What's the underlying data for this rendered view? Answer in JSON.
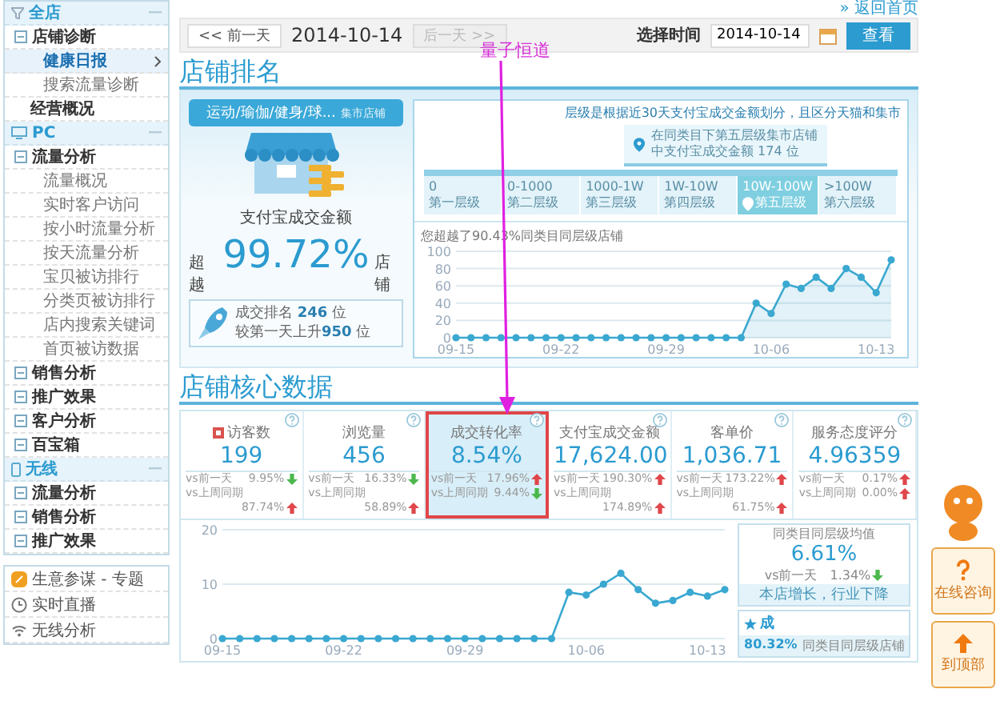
{
  "sidebar": {
    "sections": [
      {
        "title": "全店",
        "kind": "store",
        "items": [
          {
            "label": "店铺诊断",
            "kind": "group",
            "selected": false,
            "children": [
              {
                "label": "健康日报",
                "kind": "link",
                "selected": true
              },
              {
                "label": "搜索流量诊断",
                "kind": "link",
                "selected": false
              }
            ]
          },
          {
            "label": "经营概况",
            "kind": "link",
            "selected": false
          }
        ]
      },
      {
        "title": "PC",
        "kind": "pc",
        "items": [
          {
            "label": "流量分析",
            "kind": "group",
            "selected": false,
            "children": [
              {
                "label": "流量概况",
                "kind": "link",
                "selected": false
              },
              {
                "label": "实时客户访问",
                "kind": "link",
                "selected": false
              },
              {
                "label": "按小时流量分析",
                "kind": "link",
                "selected": false
              },
              {
                "label": "按天流量分析",
                "kind": "link",
                "selected": false
              },
              {
                "label": "宝贝被访排行",
                "kind": "link",
                "selected": false
              },
              {
                "label": "分类页被访排行",
                "kind": "link",
                "selected": false
              },
              {
                "label": "店内搜索关键词",
                "kind": "link",
                "selected": false
              },
              {
                "label": "首页被访数据",
                "kind": "link",
                "selected": false
              }
            ]
          },
          {
            "label": "销售分析",
            "kind": "group",
            "selected": false
          },
          {
            "label": "推广效果",
            "kind": "group",
            "selected": false
          },
          {
            "label": "客户分析",
            "kind": "group",
            "selected": false
          },
          {
            "label": "百宝箱",
            "kind": "group",
            "selected": false
          }
        ]
      },
      {
        "title": "无线",
        "kind": "mobile",
        "items": [
          {
            "label": "流量分析",
            "kind": "group",
            "selected": false
          },
          {
            "label": "销售分析",
            "kind": "group",
            "selected": false
          },
          {
            "label": "推广效果",
            "kind": "group",
            "selected": false
          }
        ]
      }
    ],
    "tools": [
      {
        "kind": "topic",
        "label": "生意参谋 - 专题"
      },
      {
        "kind": "live",
        "label": "实时直播"
      },
      {
        "kind": "wireless",
        "label": "无线分析"
      }
    ]
  },
  "top_link": "» 返回首页",
  "toolbar": {
    "prev_button": "<< 前一天",
    "date": "2014-10-14",
    "next_button": {
      "label": "后一天 >>",
      "disabled": true
    },
    "time_label": "选择时间",
    "time_input": "2014-10-14",
    "view_button": "查看"
  },
  "annotation": "量子恒道",
  "ranking": {
    "title": "店铺排名",
    "category": "运动/瑜伽/健身/球...",
    "shop_type": "集市店铺",
    "metric": "支付宝成交金额",
    "beat_prefix": "超越",
    "beat_value": "99.72%",
    "beat_suffix": "店铺",
    "rank_line": "成交排名 **246** 位",
    "rise_line": "较第一天上升**950** 位",
    "note": "层级是根据近30天支付宝成交金额划分，且区分天猫和集市",
    "tooltip": [
      "在同类目下第五层级集市店铺",
      "中支付宝成交金额 174 位"
    ],
    "tiers": [
      {
        "range": "0",
        "name": "第一层级",
        "selected": false
      },
      {
        "range": "0-1000",
        "name": "第二层级",
        "selected": false
      },
      {
        "range": "1000-1W",
        "name": "第三层级",
        "selected": false
      },
      {
        "range": "1W-10W",
        "name": "第四层级",
        "selected": false
      },
      {
        "range": "10W-100W",
        "name": "第五层级",
        "selected": true
      },
      {
        "range": ">100W",
        "name": "第六层级",
        "selected": false
      }
    ],
    "chart_data": {
      "type": "area",
      "title": "您超越了90.43%同类目同层级店铺",
      "categories": [
        "09-15",
        null,
        null,
        null,
        null,
        null,
        null,
        "09-22",
        null,
        null,
        null,
        null,
        null,
        null,
        "09-29",
        null,
        null,
        null,
        null,
        null,
        null,
        "10-06",
        null,
        null,
        null,
        null,
        null,
        null,
        "10-13",
        null
      ],
      "ylim": [
        0,
        100
      ],
      "yticks": [
        0,
        20,
        40,
        60,
        80,
        100
      ],
      "grid": true,
      "series": [
        {
          "color": "#3aa8d0",
          "marker": true,
          "values": [
            0,
            0,
            0,
            0,
            0,
            0,
            0,
            0,
            0,
            0,
            0,
            0,
            0,
            0,
            0,
            0,
            0,
            0,
            0,
            0,
            40,
            28,
            62,
            57,
            70,
            57,
            80,
            70,
            52,
            90
          ]
        }
      ]
    }
  },
  "core": {
    "title": "店铺核心数据",
    "cards": [
      {
        "label": "访客数",
        "value": "199",
        "selected": false,
        "compare": [
          {
            "label": "vs前一天",
            "value": "9.95%",
            "rising": false
          },
          {
            "label": "vs上周同期",
            "value": "87.74%",
            "rising": true
          }
        ]
      },
      {
        "label": "浏览量",
        "value": "456",
        "selected": false,
        "compare": [
          {
            "label": "vs前一天",
            "value": "16.33%",
            "rising": false
          },
          {
            "label": "vs上周同期",
            "value": "58.89%",
            "rising": true
          }
        ]
      },
      {
        "label": "成交转化率",
        "value": "8.54%",
        "selected": true,
        "compare": [
          {
            "label": "vs前一天",
            "value": "17.96%",
            "rising": true
          },
          {
            "label": "vs上周同期",
            "value": "9.44%",
            "rising": false
          }
        ]
      },
      {
        "label": "支付宝成交金额",
        "value": "17,624.00",
        "selected": false,
        "compare": [
          {
            "label": "vs前一天",
            "value": "190.30%",
            "rising": true
          },
          {
            "label": "vs上周同期",
            "value": "174.89%",
            "rising": true
          }
        ]
      },
      {
        "label": "客单价",
        "value": "1,036.71",
        "selected": false,
        "compare": [
          {
            "label": "vs前一天",
            "value": "173.22%",
            "rising": true
          },
          {
            "label": "vs上周同期",
            "value": "61.75%",
            "rising": true
          }
        ]
      },
      {
        "label": "服务态度评分",
        "value": "4.96359",
        "selected": false,
        "compare": [
          {
            "label": "vs前一天",
            "value": "0.17%",
            "rising": true
          },
          {
            "label": "vs上周同期",
            "value": "0.00%",
            "rising": true
          }
        ]
      }
    ],
    "chart_data": {
      "type": "line",
      "categories": [
        "09-15",
        null,
        null,
        null,
        null,
        null,
        null,
        "09-22",
        null,
        null,
        null,
        null,
        null,
        null,
        "09-29",
        null,
        null,
        null,
        null,
        null,
        null,
        "10-06",
        null,
        null,
        null,
        null,
        null,
        null,
        "10-13",
        null
      ],
      "ylim": [
        0,
        20
      ],
      "yticks": [
        0,
        10,
        20
      ],
      "grid": true,
      "series": [
        {
          "color": "#3aa8d0",
          "marker": true,
          "values": [
            0,
            0,
            0,
            0,
            0,
            0,
            0,
            0,
            0,
            0,
            0,
            0,
            0,
            0,
            0,
            0,
            0,
            0,
            0,
            0,
            8.5,
            8,
            10,
            12,
            9,
            6.5,
            7,
            8.5,
            7.8,
            9
          ]
        }
      ]
    },
    "benchmark": {
      "title": "同类目同层级均值",
      "value": "6.61%",
      "compare": {
        "label": "vs前一天",
        "value": "1.34%",
        "rising": false
      },
      "status": "本店增长，行业下降"
    },
    "rank_box": {
      "title": "成",
      "value": "80.32%",
      "text": "同类目同层级店铺"
    }
  },
  "float_tools": [
    {
      "kind": "consult",
      "label": "在线咨询"
    },
    {
      "kind": "top",
      "label": "到顶部"
    }
  ]
}
